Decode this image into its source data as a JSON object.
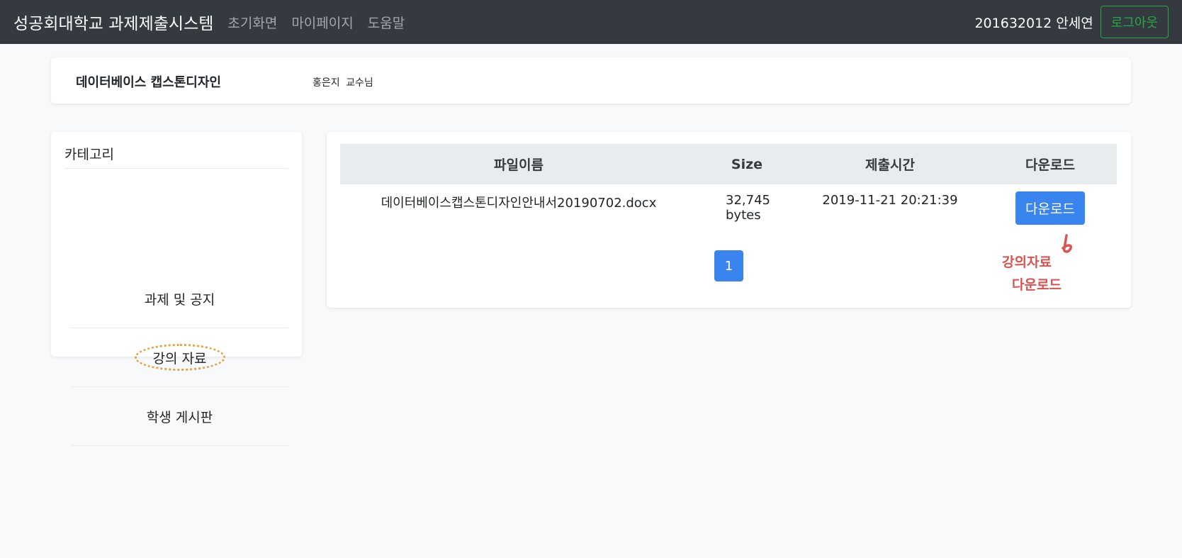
{
  "navbar": {
    "brand": "성공회대학교 과제제출시스템",
    "links": [
      "초기화면",
      "마이페이지",
      "도움말"
    ],
    "user": "201632012 안세연",
    "logout_label": "로그아웃"
  },
  "course": {
    "title": "데이터베이스 캡스톤디자인",
    "professor": "홍은지 교수님"
  },
  "category": {
    "header": "카테고리",
    "items": [
      "과제 및 공지",
      "강의 자료",
      "학생 게시판"
    ],
    "active_index": 1
  },
  "files_table": {
    "headers": [
      "파일이름",
      "Size",
      "제출시간",
      "다운로드"
    ],
    "rows": [
      {
        "filename": "데이터베이스캡스톤디자인안내서20190702.docx",
        "size": "32,745 bytes",
        "time": "2019-11-21 20:21:39",
        "button": "다운로드"
      }
    ]
  },
  "pagination": {
    "current": "1"
  },
  "annotation": {
    "lines": [
      "강의자료",
      "다운로드"
    ],
    "color": "#d9534f"
  },
  "colors": {
    "navbar": "#343a40",
    "primary": "#3a84f0",
    "logout": "#28a745",
    "highlight": "#e0a34a"
  }
}
